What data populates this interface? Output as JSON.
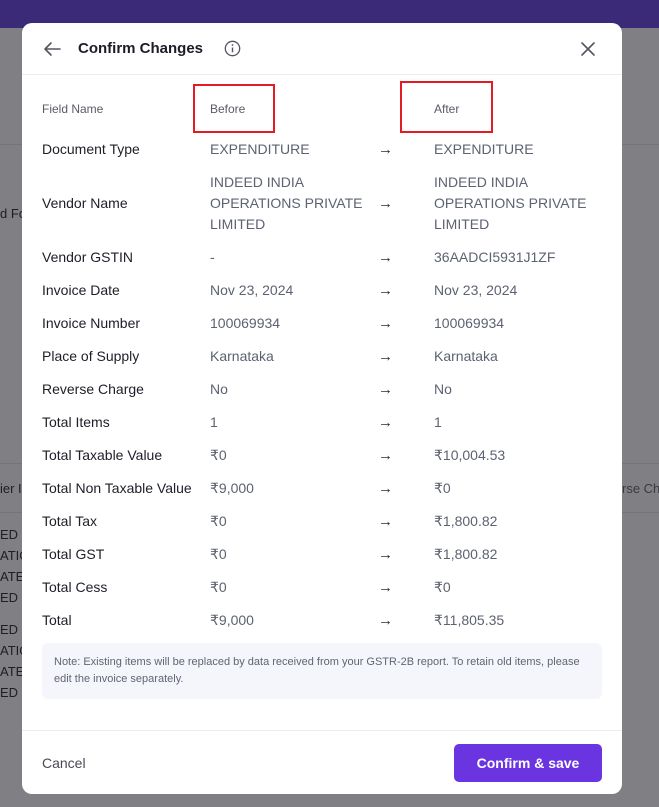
{
  "background": {
    "fragments": [
      {
        "text": "d Fo"
      },
      {
        "text": "ier I"
      },
      {
        "text": "rse Ch"
      },
      {
        "text": "ED I"
      },
      {
        "text": "ATIO"
      },
      {
        "text": "ATE"
      },
      {
        "text": "ED"
      },
      {
        "text": "ED I"
      },
      {
        "text": "ATIO"
      },
      {
        "text": "ATE"
      },
      {
        "text": "ED"
      }
    ]
  },
  "modal": {
    "title": "Confirm Changes",
    "icons": {
      "back": "arrow-left-icon",
      "info": "info-icon",
      "close": "close-icon"
    },
    "columns": {
      "field": "Field Name",
      "before": "Before",
      "after": "After"
    },
    "arrow": "→",
    "rows": [
      {
        "field": "Document Type",
        "before": "EXPENDITURE",
        "after": "EXPENDITURE"
      },
      {
        "field": "Vendor Name",
        "before": "INDEED INDIA OPERATIONS PRIVATE LIMITED",
        "after": "INDEED INDIA OPERATIONS PRIVATE LIMITED"
      },
      {
        "field": "Vendor GSTIN",
        "before": "-",
        "after": "36AADCI5931J1ZF"
      },
      {
        "field": "Invoice Date",
        "before": "Nov 23, 2024",
        "after": "Nov 23, 2024"
      },
      {
        "field": "Invoice Number",
        "before": "100069934",
        "after": "100069934"
      },
      {
        "field": "Place of Supply",
        "before": "Karnataka",
        "after": "Karnataka"
      },
      {
        "field": "Reverse Charge",
        "before": "No",
        "after": "No"
      },
      {
        "field": "Total Items",
        "before": "1",
        "after": "1"
      },
      {
        "field": "Total Taxable Value",
        "before": "₹0",
        "after": "₹10,004.53"
      },
      {
        "field": "Total Non Taxable Value",
        "before": "₹9,000",
        "after": "₹0"
      },
      {
        "field": "Total Tax",
        "before": "₹0",
        "after": "₹1,800.82"
      },
      {
        "field": "Total GST",
        "before": "₹0",
        "after": "₹1,800.82"
      },
      {
        "field": "Total Cess",
        "before": "₹0",
        "after": "₹0"
      },
      {
        "field": "Total",
        "before": "₹9,000",
        "after": "₹11,805.35"
      }
    ],
    "note": "Note: Existing items will be replaced by data received from your GSTR-2B report. To retain old items, please edit the invoice separately.",
    "cancel_label": "Cancel",
    "confirm_label": "Confirm & save"
  },
  "colors": {
    "accent": "#6a35e0",
    "highlight": "#e41b23",
    "topbar": "#3b2a78"
  }
}
